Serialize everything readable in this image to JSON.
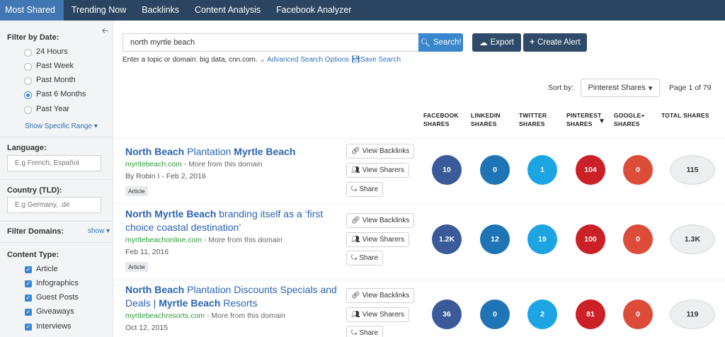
{
  "nav": {
    "tabs": [
      {
        "label": "Most Shared"
      },
      {
        "label": "Trending Now"
      },
      {
        "label": "Backlinks"
      },
      {
        "label": "Content Analysis"
      },
      {
        "label": "Facebook Analyzer"
      }
    ]
  },
  "sidebar": {
    "date_heading": "Filter by Date:",
    "date_options": [
      {
        "label": "24 Hours"
      },
      {
        "label": "Past Week"
      },
      {
        "label": "Past Month"
      },
      {
        "label": "Past 6 Months"
      },
      {
        "label": "Past Year"
      }
    ],
    "date_selected": "Past 6 Months",
    "show_range_link": "Show Specific Range",
    "language_heading": "Language:",
    "language_placeholder": "E.g French, Español",
    "country_heading": "Country (TLD):",
    "country_placeholder": "E.g Germany, .de",
    "domains_heading": "Filter Domains:",
    "domains_show": "show",
    "content_type_heading": "Content Type:",
    "content_types": [
      {
        "label": "Article",
        "checked": true
      },
      {
        "label": "Infographics",
        "checked": true
      },
      {
        "label": "Guest Posts",
        "checked": true
      },
      {
        "label": "Giveaways",
        "checked": true
      },
      {
        "label": "Interviews",
        "checked": true
      }
    ]
  },
  "search": {
    "value": "north myrtle beach",
    "button_label": "Search!",
    "export_label": "Export",
    "alert_label": "Create Alert",
    "hint": "Enter a topic or domain: big data, cnn.com.",
    "advanced_link": "Advanced Search Options",
    "save_link": "Save Search"
  },
  "sort": {
    "label": "Sort by:",
    "selected": "Pinterest Shares",
    "page_info": "Page 1 of 79"
  },
  "columns": {
    "facebook": [
      "FACEBOOK",
      "SHARES"
    ],
    "linkedin": [
      "LINKEDIN",
      "SHARES"
    ],
    "twitter": [
      "TWITTER",
      "SHARES"
    ],
    "pinterest": [
      "PINTEREST",
      "SHARES"
    ],
    "googleplus": [
      "GOOGLE+",
      "SHARES"
    ],
    "total": [
      "TOTAL SHARES"
    ]
  },
  "actions": {
    "backlinks": "View Backlinks",
    "sharers": "View Sharers",
    "share": "Share"
  },
  "results": [
    {
      "title_parts": [
        {
          "text": "North Beach",
          "bold": true
        },
        {
          "text": " Plantation ",
          "bold": false
        },
        {
          "text": "Myrtle Beach",
          "bold": true
        }
      ],
      "domain": "myrtlebeach.com",
      "more": " - More from this domain",
      "meta": "By Robin I - Feb 2, 2016",
      "tag": "Article",
      "shares": {
        "facebook": "10",
        "linkedin": "0",
        "twitter": "1",
        "pinterest": "104",
        "googleplus": "0",
        "total": "115"
      }
    },
    {
      "title_parts": [
        {
          "text": "North Myrtle Beach",
          "bold": true
        },
        {
          "text": " branding itself as a ‘first choice coastal destination’",
          "bold": false
        }
      ],
      "domain": "myrtlebeachonline.com",
      "more": " - More from this domain",
      "meta": "Feb 11, 2016",
      "tag": "Article",
      "shares": {
        "facebook": "1.2K",
        "linkedin": "12",
        "twitter": "19",
        "pinterest": "100",
        "googleplus": "0",
        "total": "1.3K"
      }
    },
    {
      "title_parts": [
        {
          "text": "North Beach",
          "bold": true
        },
        {
          "text": " Plantation Discounts Specials and Deals | ",
          "bold": false
        },
        {
          "text": "Myrtle Beach",
          "bold": true
        },
        {
          "text": " Resorts",
          "bold": false
        }
      ],
      "domain": "myrtlebeachresorts.com",
      "more": " - More from this domain",
      "meta": "Oct 12, 2015",
      "tag": "",
      "shares": {
        "facebook": "36",
        "linkedin": "0",
        "twitter": "2",
        "pinterest": "81",
        "googleplus": "0",
        "total": "119"
      }
    }
  ],
  "colors": {
    "nav_bg": "#2b4461",
    "nav_active": "#4178b3",
    "facebook": "#3a5a9a",
    "linkedin": "#1f74b5",
    "twitter": "#1ca4e3",
    "pinterest": "#cb2027",
    "googleplus": "#dd4b39"
  }
}
